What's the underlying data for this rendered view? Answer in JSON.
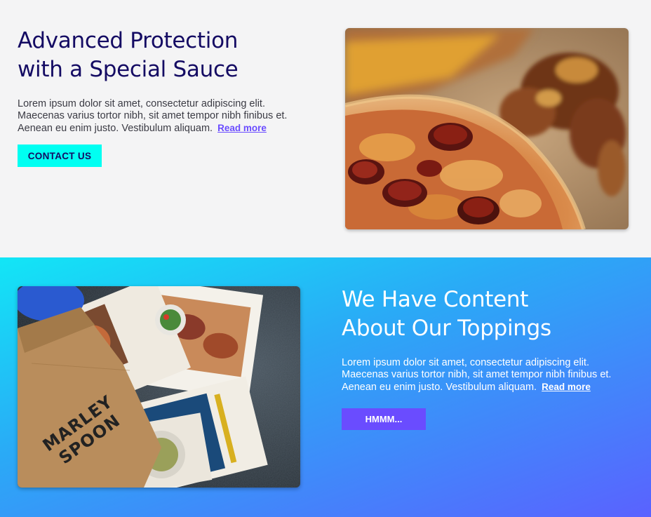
{
  "section1": {
    "heading_line1": "Advanced Protection",
    "heading_line2": "with a Special Sauce",
    "para_line1": "Lorem ipsum dolor sit amet, consectetur adipiscing elit.",
    "para_line2": "Maecenas varius tortor nibh, sit amet tempor nibh finibus et.",
    "para_line3": "Aenean eu enim justo. Vestibulum aliquam.",
    "read_more": "Read more",
    "button": "CONTACT US"
  },
  "section2": {
    "heading_line1": "We Have Content",
    "heading_line2": "About Our Toppings",
    "para_line1": "Lorem ipsum dolor sit amet, consectetur adipiscing elit.",
    "para_line2": "Maecenas varius tortor nibh, sit amet tempor nibh finibus et.",
    "para_line3": "Aenean eu enim justo. Vestibulum aliquam.",
    "read_more": "Read more",
    "button": "HMMM...",
    "bag_text_line1": "MARLEY",
    "bag_text_line2": "SPOON"
  },
  "colors": {
    "heading_dark": "#140b63",
    "cyan_button": "#00fff2",
    "purple_button": "#6a4cff",
    "gradient_start": "#12e6f6",
    "gradient_end": "#5a62ff"
  }
}
